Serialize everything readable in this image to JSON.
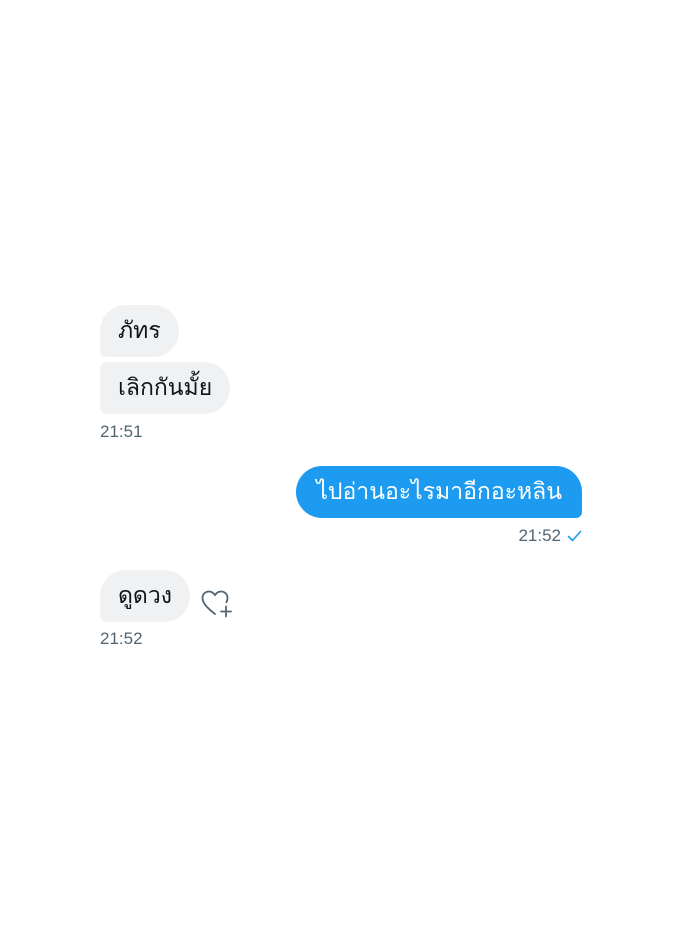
{
  "conversation": {
    "group1": {
      "messages": [
        {
          "text": "ภัทร"
        },
        {
          "text": "เลิกกันมั้ย"
        }
      ],
      "time": "21:51"
    },
    "group2": {
      "messages": [
        {
          "text": "ไปอ่านอะไรมาอีกอะหลิน"
        }
      ],
      "time": "21:52",
      "status_icon": "check-icon"
    },
    "group3": {
      "messages": [
        {
          "text": "ดูดวง"
        }
      ],
      "time": "21:52",
      "reaction_icon": "heart-plus-icon"
    }
  },
  "colors": {
    "incoming_bubble": "#eff1f3",
    "outgoing_bubble": "#1d9bf0",
    "timestamp": "#536471"
  }
}
